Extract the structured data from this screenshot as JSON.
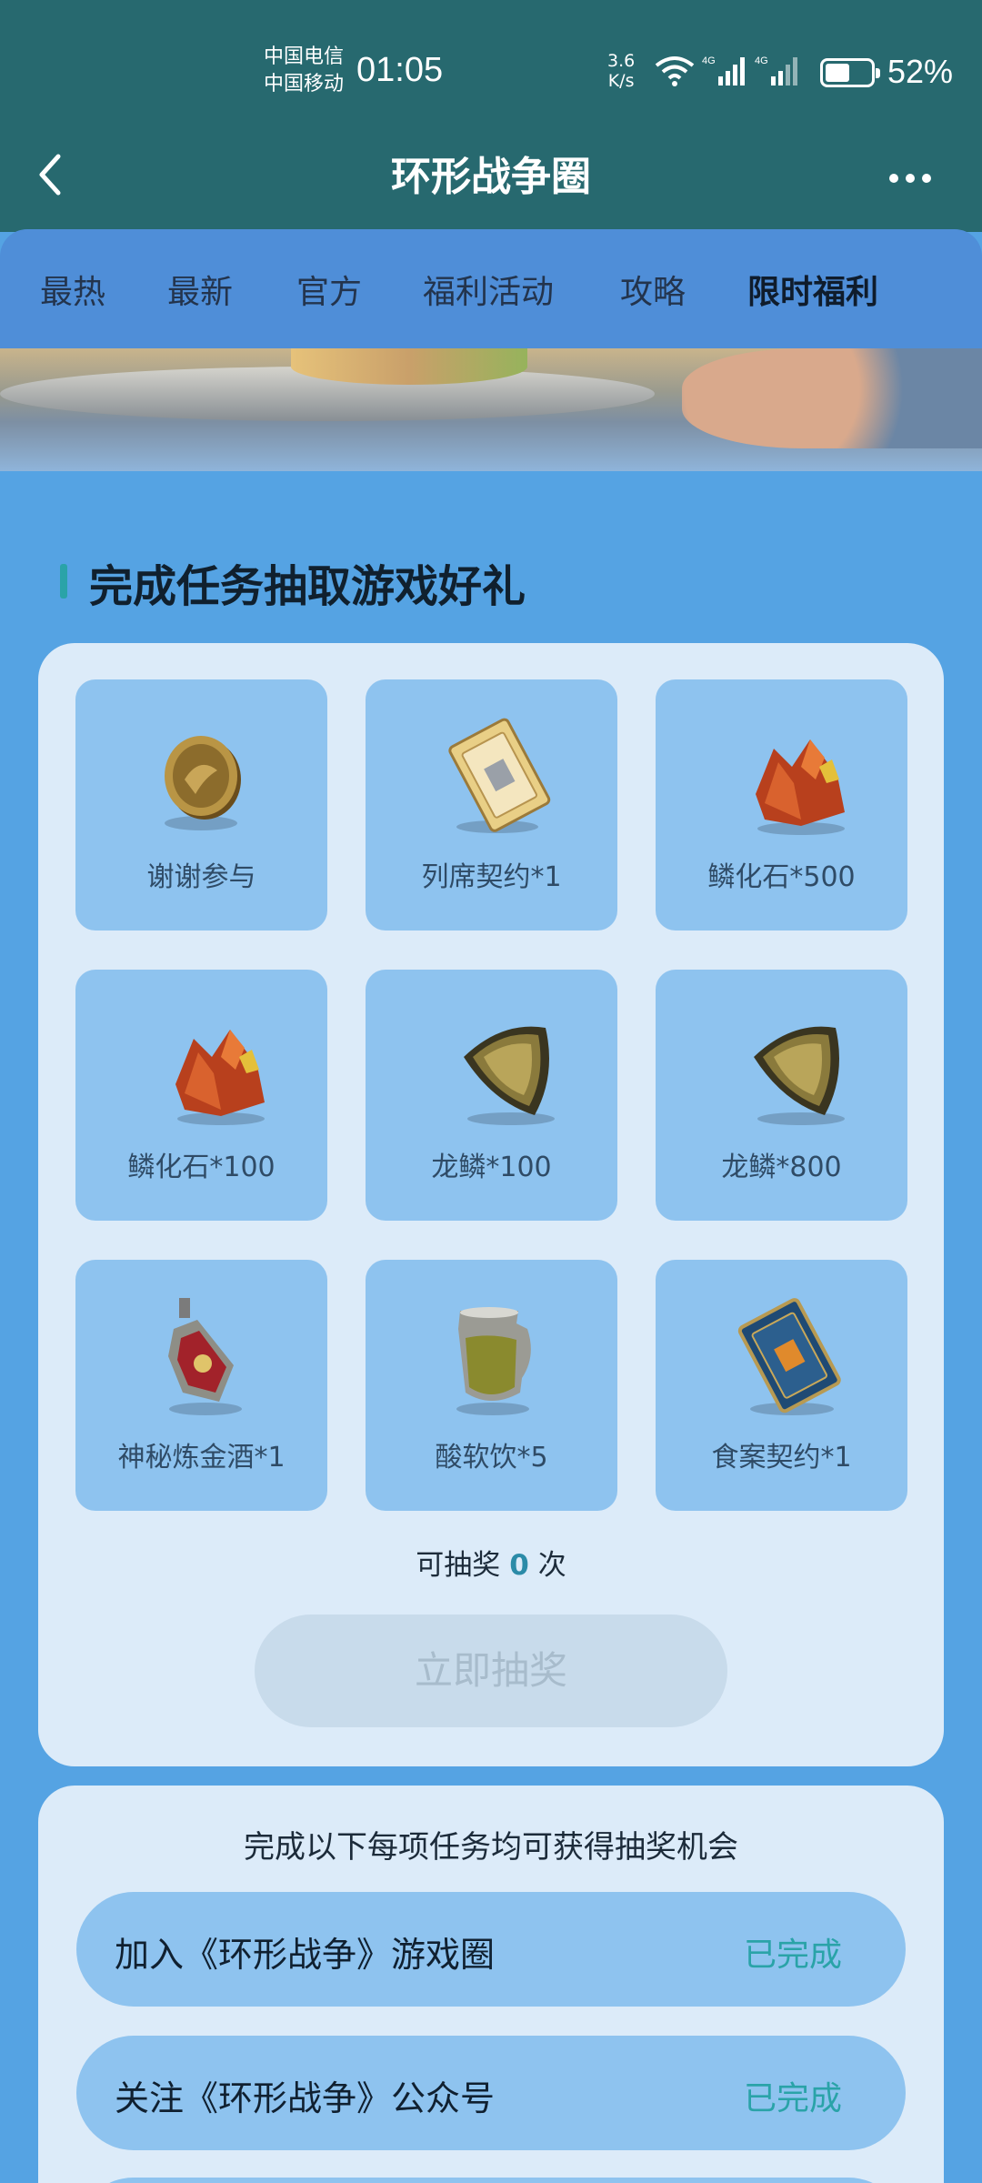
{
  "status_bar": {
    "carrier1": "中国电信",
    "carrier2": "中国移动",
    "time": "01:05",
    "net_speed_value": "3.6",
    "net_speed_unit": "K/s",
    "battery": "52%"
  },
  "header": {
    "title": "环形战争圈"
  },
  "tabs": [
    {
      "label": "最热"
    },
    {
      "label": "最新"
    },
    {
      "label": "官方"
    },
    {
      "label": "福利活动"
    },
    {
      "label": "攻略"
    },
    {
      "label": "限时福利",
      "active": true
    }
  ],
  "section": {
    "title": "完成任务抽取游戏好礼"
  },
  "prizes": [
    {
      "label": "谢谢参与",
      "icon": "coin-icon"
    },
    {
      "label": "列席契约*1",
      "icon": "contract-card-icon"
    },
    {
      "label": "鳞化石*500",
      "icon": "red-crystal-icon"
    },
    {
      "label": "鳞化石*100",
      "icon": "red-crystal-icon"
    },
    {
      "label": "龙鳞*100",
      "icon": "dragon-scale-icon"
    },
    {
      "label": "龙鳞*800",
      "icon": "dragon-scale-icon"
    },
    {
      "label": "神秘炼金酒*1",
      "icon": "potion-bottle-icon"
    },
    {
      "label": "酸软饮*5",
      "icon": "pitcher-icon"
    },
    {
      "label": "食案契约*1",
      "icon": "blue-card-icon"
    }
  ],
  "draw": {
    "prefix": "可抽奖",
    "count": "0",
    "suffix": "次",
    "button_label": "立即抽奖"
  },
  "tasks": {
    "hint": "完成以下每项任务均可获得抽奖机会",
    "items": [
      {
        "name": "加入《环形战争》游戏圈",
        "status": "已完成"
      },
      {
        "name": "关注《环形战争》公众号",
        "status": "已完成"
      }
    ]
  }
}
